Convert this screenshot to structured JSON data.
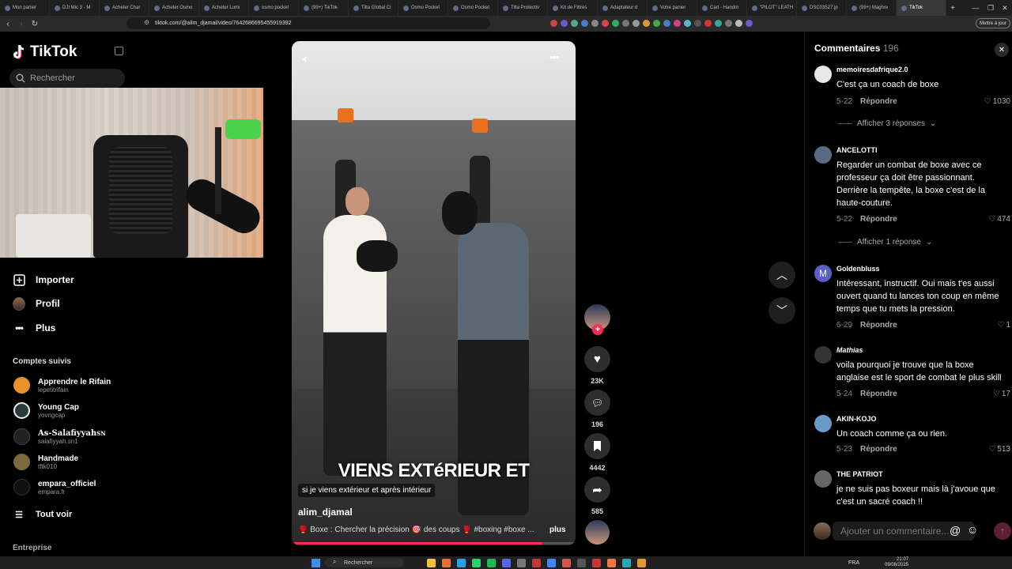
{
  "browser": {
    "tabs": [
      {
        "label": "Mon panier"
      },
      {
        "label": "DJI Mic 3 - M"
      },
      {
        "label": "Acheter Char"
      },
      {
        "label": "Acheter Osmo"
      },
      {
        "label": "Acheter Lumi"
      },
      {
        "label": "osmo pocket"
      },
      {
        "label": "(99+) TikTok"
      },
      {
        "label": "Tilta Global Ci"
      },
      {
        "label": "Osmo Pocket"
      },
      {
        "label": "Osmo Pocket"
      },
      {
        "label": "Tilta Protectiv"
      },
      {
        "label": "Kit de Filtres"
      },
      {
        "label": "Adaptateur d"
      },
      {
        "label": "Votre panier"
      },
      {
        "label": "Cart - Handm"
      },
      {
        "label": "\"PILOT\" LEATH"
      },
      {
        "label": "DSC03527.jp"
      },
      {
        "label": "(99+) Maghre"
      },
      {
        "label": "TikTok"
      }
    ],
    "url": "tiktok.com/@alim_djamal/video/7642686695455919392",
    "update_label": "Mettre à jour"
  },
  "sidebar": {
    "logo": "TikTok",
    "search_placeholder": "Rechercher",
    "nav": [
      {
        "label": "Importer",
        "icon": "upload-icon"
      },
      {
        "label": "Profil",
        "icon": "profile-avatar"
      },
      {
        "label": "Plus",
        "icon": "more-icon"
      }
    ],
    "following_title": "Comptes suivis",
    "accounts": [
      {
        "name": "Apprendre le Rifain",
        "handle": "lepetitrifain",
        "color": "#e8912d"
      },
      {
        "name": "Young Cap",
        "handle": "yovngcap",
        "color": "#2a3b3a"
      },
      {
        "name": "As-Salafiyyah",
        "handle": "salafiyyah.sn1",
        "suffix": "SN",
        "color": "#222222"
      },
      {
        "name": "Handmade",
        "handle": "tftk010",
        "color": "#7a6a3a"
      },
      {
        "name": "empara_officiel",
        "handle": "empara.fr",
        "color": "#111111"
      }
    ],
    "see_all": "Tout voir",
    "section_bottom": "Entreprise"
  },
  "video": {
    "subtitle": "VIENS EXTéRIEUR ET",
    "caption": "si je viens extérieur et après intérieur",
    "author": "alim_djamal",
    "description": "🥊 Boxe : Chercher la précision 🎯 des coups 🥊 #boxing #boxe ...",
    "more": "plus",
    "progress": 0.88
  },
  "actions": {
    "likes": "23K",
    "comments": "196",
    "saves": "4442",
    "shares": "585"
  },
  "comments_panel": {
    "title": "Commentaires",
    "count": "196",
    "reply_label": "Répondre",
    "items": [
      {
        "user": "memoiresdafrique2.0",
        "text": "C'est ça un coach de boxe",
        "date": "5-22",
        "likes": "1030",
        "replies": "Afficher 3 réponses",
        "color": "#e8e8e8"
      },
      {
        "user": "ANCELOTTI",
        "text": "Regarder un combat de boxe avec ce professeur ça doit être passionnant. Derrière la tempête, la boxe c'est de la haute-couture.",
        "date": "5-22",
        "likes": "474",
        "replies": "Afficher 1 réponse",
        "color": "#5a6a80"
      },
      {
        "user": "Goldenbluss",
        "text": "Intéressant, instructif. Oui mais t'es aussi ouvert quand tu lances ton coup en même temps que tu mets la pression.",
        "date": "6-29",
        "likes": "1",
        "color": "#5b5fc7",
        "initial": "M"
      },
      {
        "user": "Mathias",
        "text": "voila pourquoi je trouve que la boxe anglaise est le sport de combat le plus skill",
        "date": "5-24",
        "likes": "17",
        "color": "#333333"
      },
      {
        "user": "AKIN-KOJO",
        "text": "Un coach comme ça ou rien.",
        "date": "5-23",
        "likes": "513",
        "color": "#6a9ac9"
      },
      {
        "user": "THE PATRIOT",
        "text": "je ne suis pas boxeur mais là j'avoue que c'est un sacré coach !!",
        "color": "#666666"
      }
    ],
    "input_placeholder": "Ajouter un commentaire..."
  },
  "taskbar": {
    "search": "Rechercher",
    "lang": "FRA",
    "time": "21:07",
    "date": "09/08/2025"
  }
}
